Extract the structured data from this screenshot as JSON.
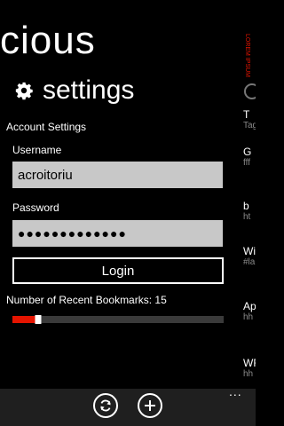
{
  "app": {
    "title_fragment": "cious"
  },
  "pivot": {
    "current_label": "settings"
  },
  "settings": {
    "section_title": "Account Settings",
    "username_label": "Username",
    "username_value": "acroitoriu",
    "password_label": "Password",
    "password_value": "●●●●●●●●●●●●●",
    "login_label": "Login",
    "bookmarks_label": "Number of Recent Bookmarks: 15",
    "bookmarks_value": 15,
    "bookmarks_slider_fraction": 0.12
  },
  "peek": {
    "vertical_text": "LOREM IPSUM",
    "items": [
      {
        "title": "T",
        "sub": "Tag"
      },
      {
        "title": "G",
        "sub": "fff"
      },
      {
        "title": "b",
        "sub": "ht"
      },
      {
        "title": "Wi",
        "sub": "#la"
      },
      {
        "title": "Ap",
        "sub": "hh"
      },
      {
        "title": "WF",
        "sub": "hh"
      }
    ]
  },
  "appbar": {
    "ellipsis": "..."
  },
  "icons": {
    "pivot": "gear-icon",
    "appbar": [
      "sync-icon",
      "add-icon"
    ]
  },
  "colors": {
    "background": "#000000",
    "accent": "#e51400",
    "textbox": "#c8c8c8",
    "appbar": "#1f1f1f"
  }
}
